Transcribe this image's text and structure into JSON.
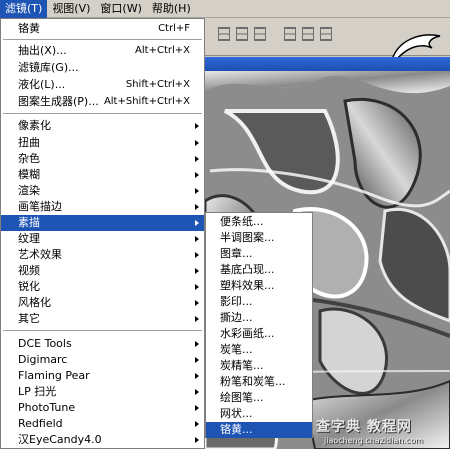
{
  "menubar": [
    {
      "label": "滤镜(T)",
      "active": true
    },
    {
      "label": "视图(V)",
      "active": false
    },
    {
      "label": "窗口(W)",
      "active": false
    },
    {
      "label": "帮助(H)",
      "active": false
    }
  ],
  "menu": {
    "items": [
      {
        "label": "铬黄",
        "shortcut": "Ctrl+F",
        "arrow": false
      },
      {
        "label": "抽出(X)...",
        "shortcut": "Alt+Ctrl+X",
        "arrow": false
      },
      {
        "label": "滤镜库(G)...",
        "shortcut": "",
        "arrow": false
      },
      {
        "label": "液化(L)...",
        "shortcut": "Shift+Ctrl+X",
        "arrow": false
      },
      {
        "label": "图案生成器(P)...",
        "shortcut": "Alt+Shift+Ctrl+X",
        "arrow": false
      },
      {
        "label": "像素化",
        "shortcut": "",
        "arrow": true
      },
      {
        "label": "扭曲",
        "shortcut": "",
        "arrow": true
      },
      {
        "label": "杂色",
        "shortcut": "",
        "arrow": true
      },
      {
        "label": "模糊",
        "shortcut": "",
        "arrow": true
      },
      {
        "label": "渲染",
        "shortcut": "",
        "arrow": true
      },
      {
        "label": "画笔描边",
        "shortcut": "",
        "arrow": true
      },
      {
        "label": "素描",
        "shortcut": "",
        "arrow": true,
        "highlight": true
      },
      {
        "label": "纹理",
        "shortcut": "",
        "arrow": true
      },
      {
        "label": "艺术效果",
        "shortcut": "",
        "arrow": true
      },
      {
        "label": "视频",
        "shortcut": "",
        "arrow": true
      },
      {
        "label": "锐化",
        "shortcut": "",
        "arrow": true
      },
      {
        "label": "风格化",
        "shortcut": "",
        "arrow": true
      },
      {
        "label": "其它",
        "shortcut": "",
        "arrow": true
      },
      {
        "label": "DCE Tools",
        "shortcut": "",
        "arrow": true
      },
      {
        "label": "Digimarc",
        "shortcut": "",
        "arrow": true
      },
      {
        "label": "Flaming Pear",
        "shortcut": "",
        "arrow": true
      },
      {
        "label": "LP 扫光",
        "shortcut": "",
        "arrow": true
      },
      {
        "label": "PhotoTune",
        "shortcut": "",
        "arrow": true
      },
      {
        "label": "Redfield",
        "shortcut": "",
        "arrow": true
      },
      {
        "label": "汉EyeCandy4.0",
        "shortcut": "",
        "arrow": true
      }
    ]
  },
  "submenu": {
    "items": [
      {
        "label": "便条纸..."
      },
      {
        "label": "半调图案..."
      },
      {
        "label": "图章..."
      },
      {
        "label": "基底凸现..."
      },
      {
        "label": "塑料效果..."
      },
      {
        "label": "影印..."
      },
      {
        "label": "撕边..."
      },
      {
        "label": "水彩画纸..."
      },
      {
        "label": "炭笔..."
      },
      {
        "label": "炭精笔..."
      },
      {
        "label": "粉笔和炭笔..."
      },
      {
        "label": "绘图笔..."
      },
      {
        "label": "网状..."
      },
      {
        "label": "铬黄...",
        "highlight": true
      }
    ]
  },
  "watermark": {
    "main": "查字典 教程网",
    "sub": "jiaocheng.chazidian.com"
  },
  "colors": {
    "highlight": "#1e55b5",
    "menubar": "#d4d0c8",
    "titlebar": "#2f6ad8"
  }
}
